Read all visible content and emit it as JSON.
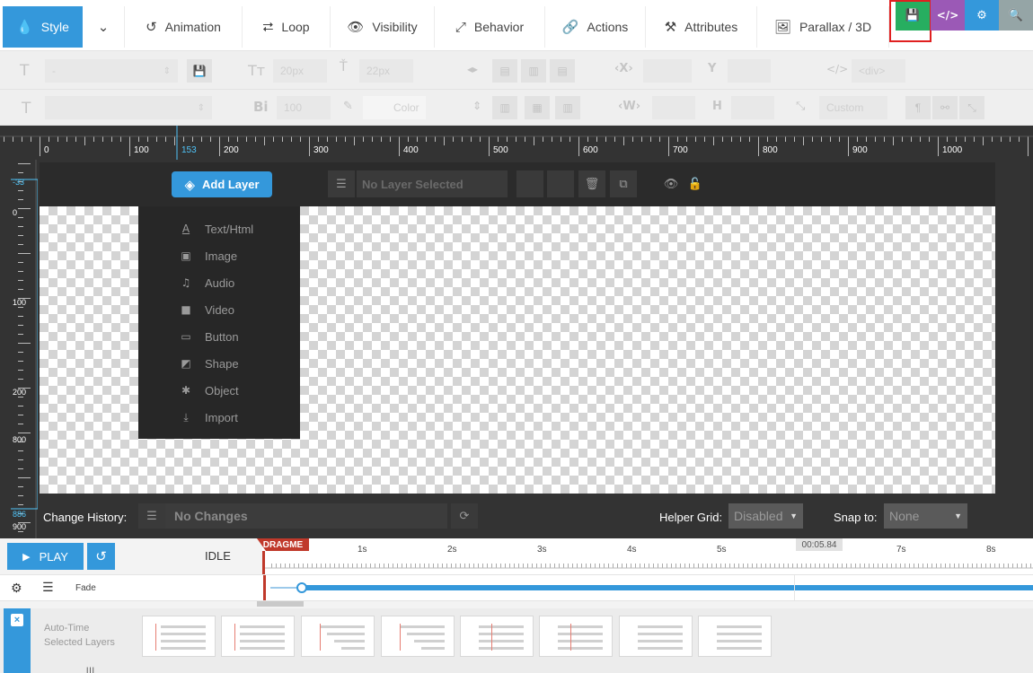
{
  "tabs": {
    "style_label": "Style",
    "animation_label": "Animation",
    "loop_label": "Loop",
    "visibility_label": "Visibility",
    "behavior_label": "Behavior",
    "actions_label": "Actions",
    "attributes_label": "Attributes",
    "parallax_label": "Parallax / 3D",
    "code_label": "</>"
  },
  "colors": {
    "accent": "#3498db",
    "save": "#27ae60",
    "code": "#9b59b6",
    "search": "#95a5a6",
    "dragme": "#c0392b",
    "highlight": "#e02020"
  },
  "toolbar": {
    "font_size": "20px",
    "line_height": "22px",
    "tag": "<div>",
    "font_weight": "100",
    "color_label": "Color",
    "x_label": "X",
    "y_label": "Y",
    "w_label": "W",
    "h_label": "H",
    "size_preset": "Custom",
    "font_placeholder": "-"
  },
  "ruler": {
    "h_marks": [
      "0",
      "100",
      "153",
      "200",
      "300",
      "400",
      "500",
      "600",
      "700",
      "800",
      "900",
      "1000"
    ],
    "v_marks": [
      "-33",
      "0",
      "100",
      "200",
      "800",
      "886",
      "900"
    ]
  },
  "layers": {
    "add_layer_label": "Add Layer",
    "no_layer_selected": "No Layer Selected",
    "menu": [
      {
        "icon": "text-icon",
        "label": "Text/Html"
      },
      {
        "icon": "image-icon",
        "label": "Image"
      },
      {
        "icon": "audio-icon",
        "label": "Audio"
      },
      {
        "icon": "video-icon",
        "label": "Video"
      },
      {
        "icon": "button-icon",
        "label": "Button"
      },
      {
        "icon": "shape-icon",
        "label": "Shape"
      },
      {
        "icon": "object-icon",
        "label": "Object"
      },
      {
        "icon": "import-icon",
        "label": "Import"
      }
    ]
  },
  "bottom": {
    "change_history_label": "Change History:",
    "no_changes": "No Changes",
    "helper_grid_label": "Helper Grid:",
    "helper_grid_value": "Disabled",
    "snap_label": "Snap to:",
    "snap_value": "None"
  },
  "timeline": {
    "play_label": "PLAY",
    "state": "IDLE",
    "dragme_label": "DRAGME",
    "time_marks": [
      "1s",
      "2s",
      "3s",
      "4s",
      "5s",
      "7s",
      "8s"
    ],
    "current_time": "00:05.84",
    "layer_name": "Fade",
    "auto_time_label": "Auto-Time",
    "selected_layers_label": "Selected Layers"
  }
}
